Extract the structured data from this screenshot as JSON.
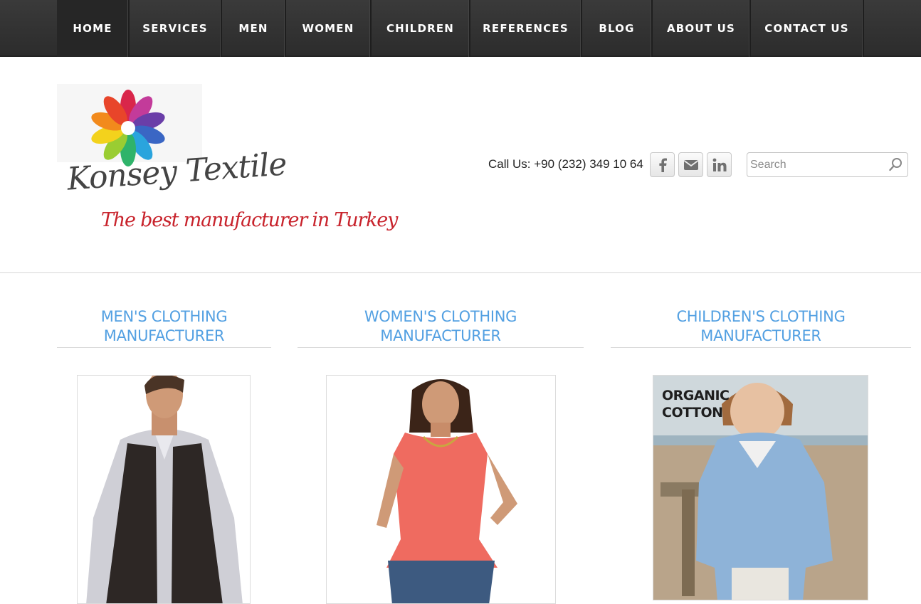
{
  "nav": {
    "items": [
      "HOME",
      "SERVICES",
      "MEN",
      "WOMEN",
      "CHILDREN",
      "REFERENCES",
      "BLOG",
      "ABOUT US",
      "CONTACT US"
    ]
  },
  "header": {
    "brand": "Konsey Textile",
    "tagline": "The best manufacturer in Turkey",
    "call": "Call Us: +90 (232) 349 10 64",
    "search_placeholder": "Search"
  },
  "columns": [
    {
      "title_line1": "MEN'S CLOTHING",
      "title_line2": "MANUFACTURER"
    },
    {
      "title_line1": "WOMEN'S CLOTHING",
      "title_line2": "MANUFACTURER"
    },
    {
      "title_line1": "CHILDREN'S CLOTHING",
      "title_line2": "MANUFACTURER",
      "badge_line1": "ORGANIC",
      "badge_line2": "COTTON"
    }
  ],
  "colors": {
    "nav_bg": "#333333",
    "heading_blue": "#53a0e2",
    "tagline_red": "#c8232c"
  },
  "icons": [
    "facebook-icon",
    "mail-icon",
    "linkedin-icon",
    "search-icon"
  ]
}
